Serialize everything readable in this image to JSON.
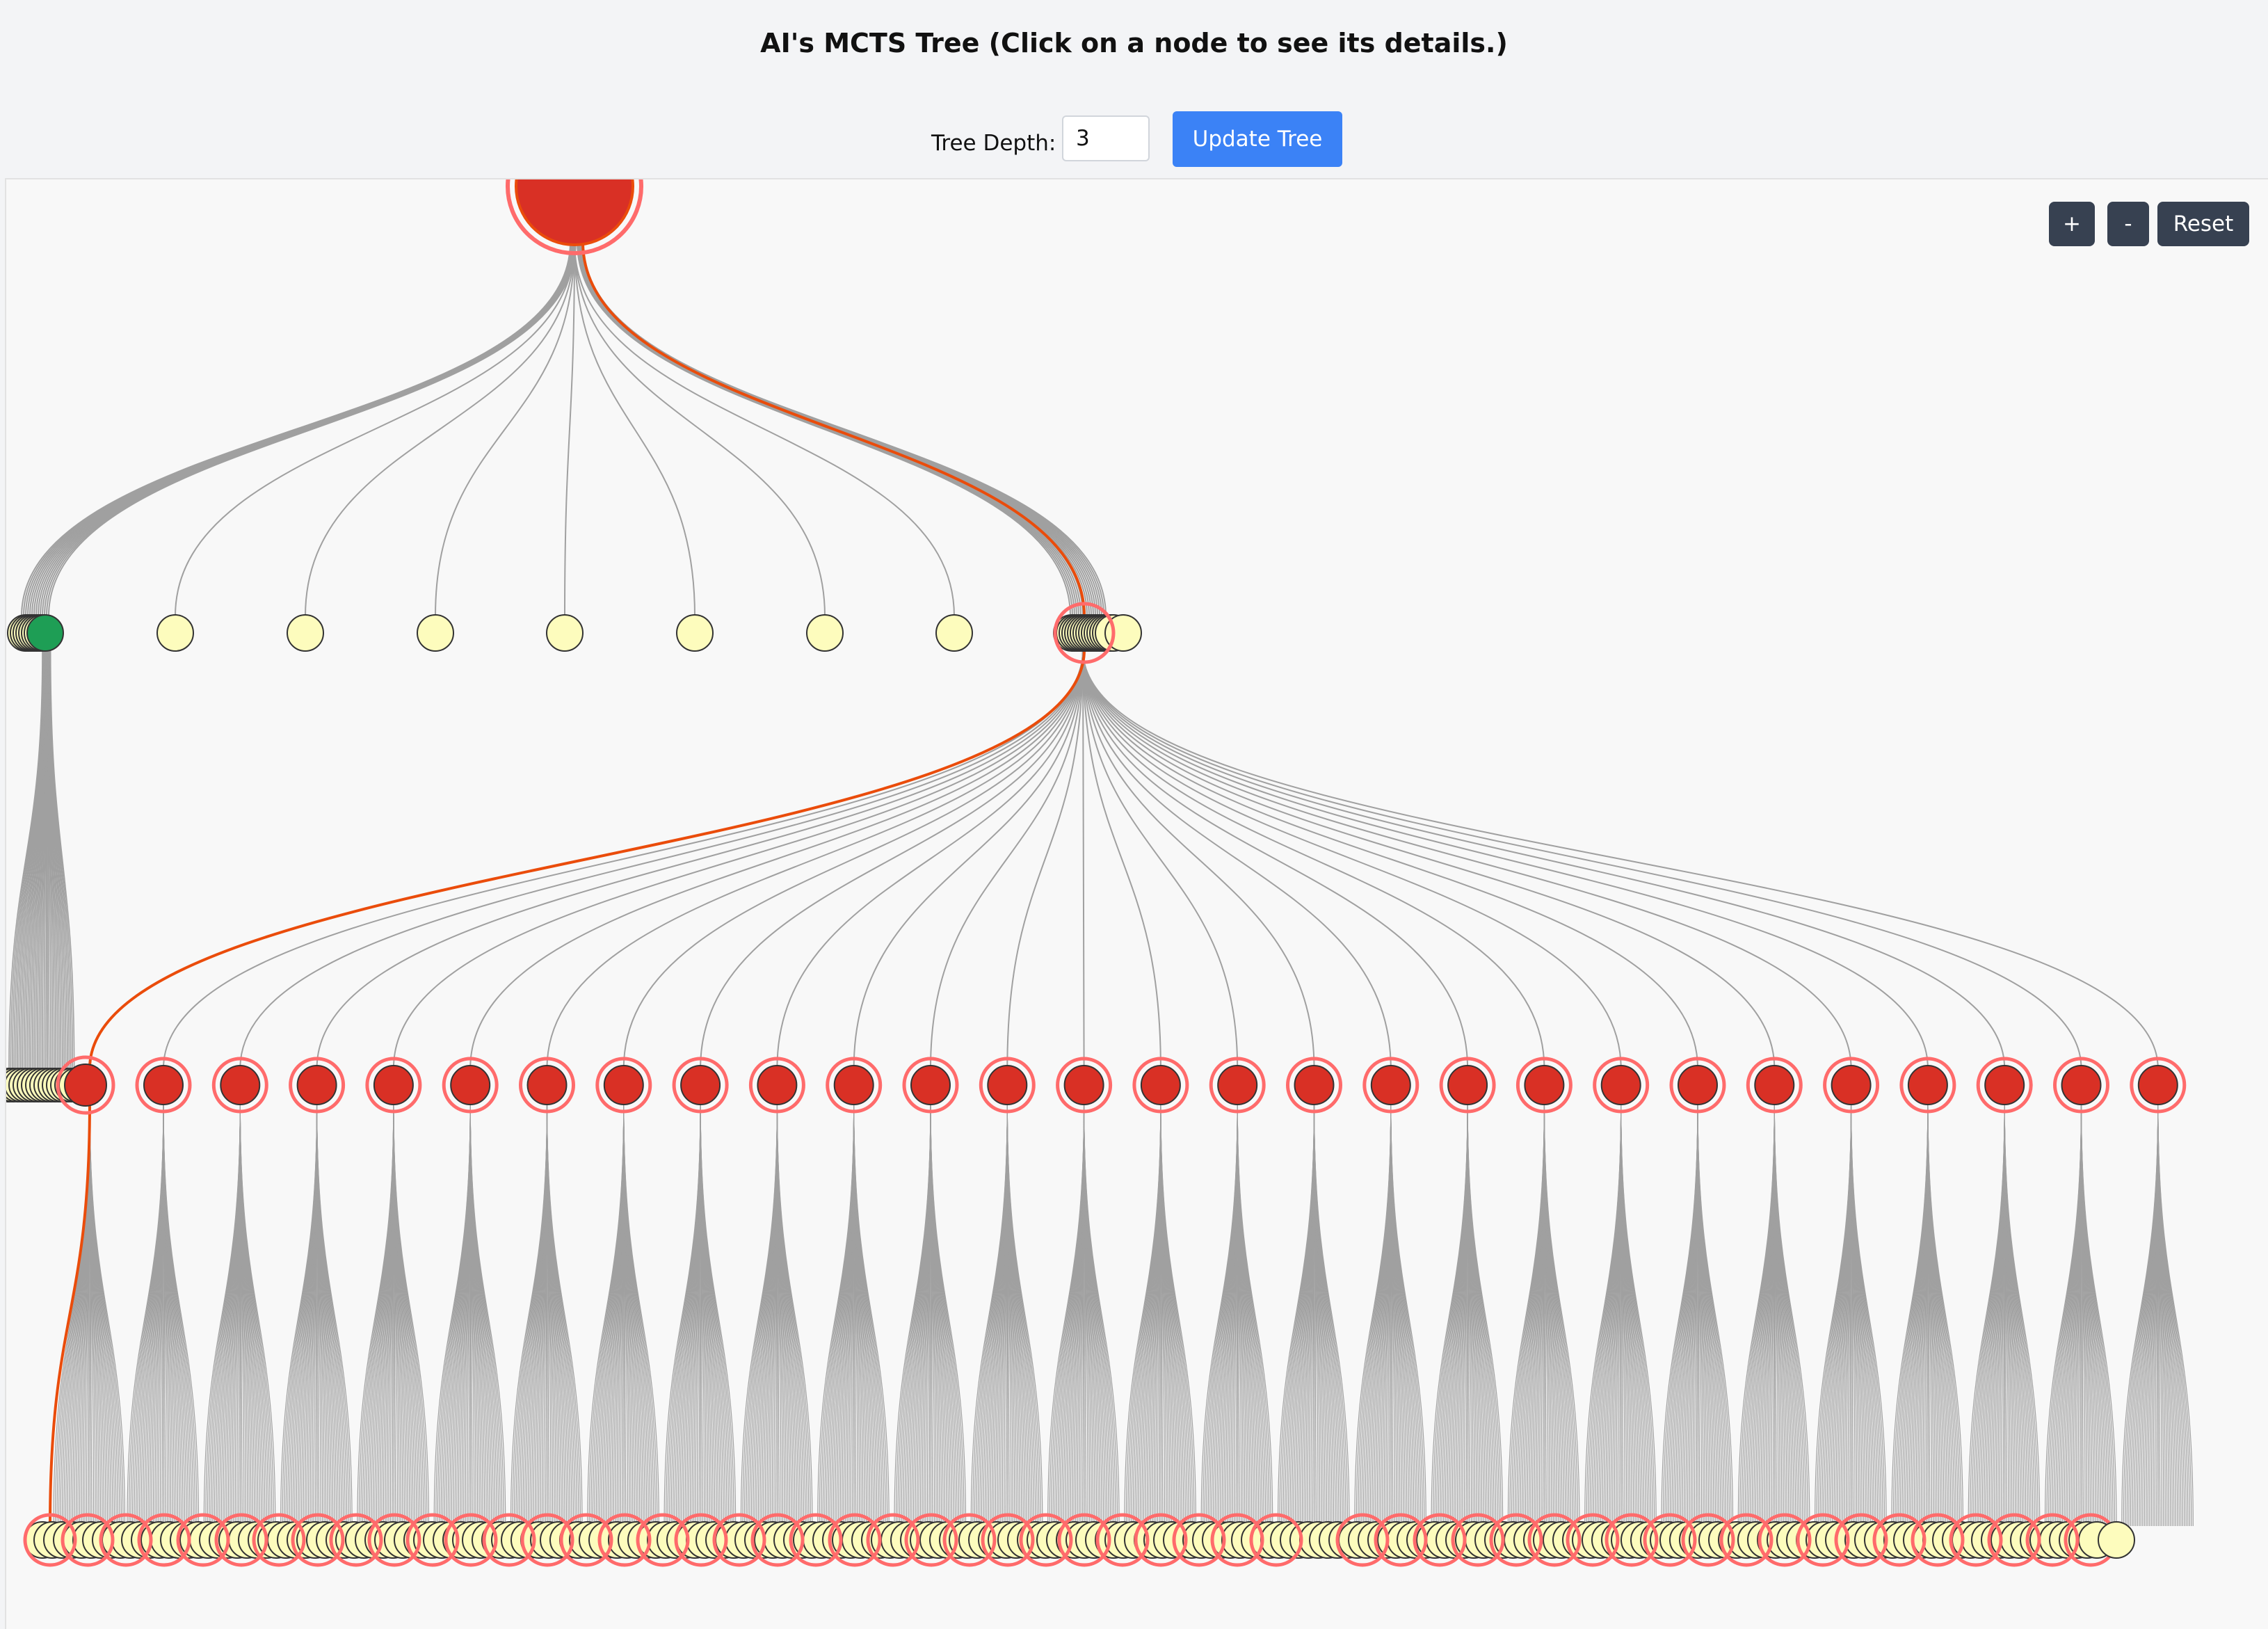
{
  "header": {
    "title": "AI's MCTS Tree (Click on a node to see its details.)"
  },
  "controls": {
    "depth_label": "Tree Depth:",
    "depth_value": "3",
    "update_label": "Update Tree"
  },
  "zoom": {
    "zoom_in_label": "+",
    "zoom_out_label": "-",
    "reset_label": "Reset"
  },
  "tree": {
    "depth_levels": 4,
    "level1_node_count": 9,
    "level2_node_count": 28,
    "colors": {
      "unvisited": "#fdfcbd",
      "ai_move": "#d93025",
      "best": "#1e9e55",
      "highlight_ring": "#ff6b6b",
      "best_path": "#ea4c0b",
      "edge": "#a0a0a0",
      "node_stroke": "#333333"
    }
  }
}
